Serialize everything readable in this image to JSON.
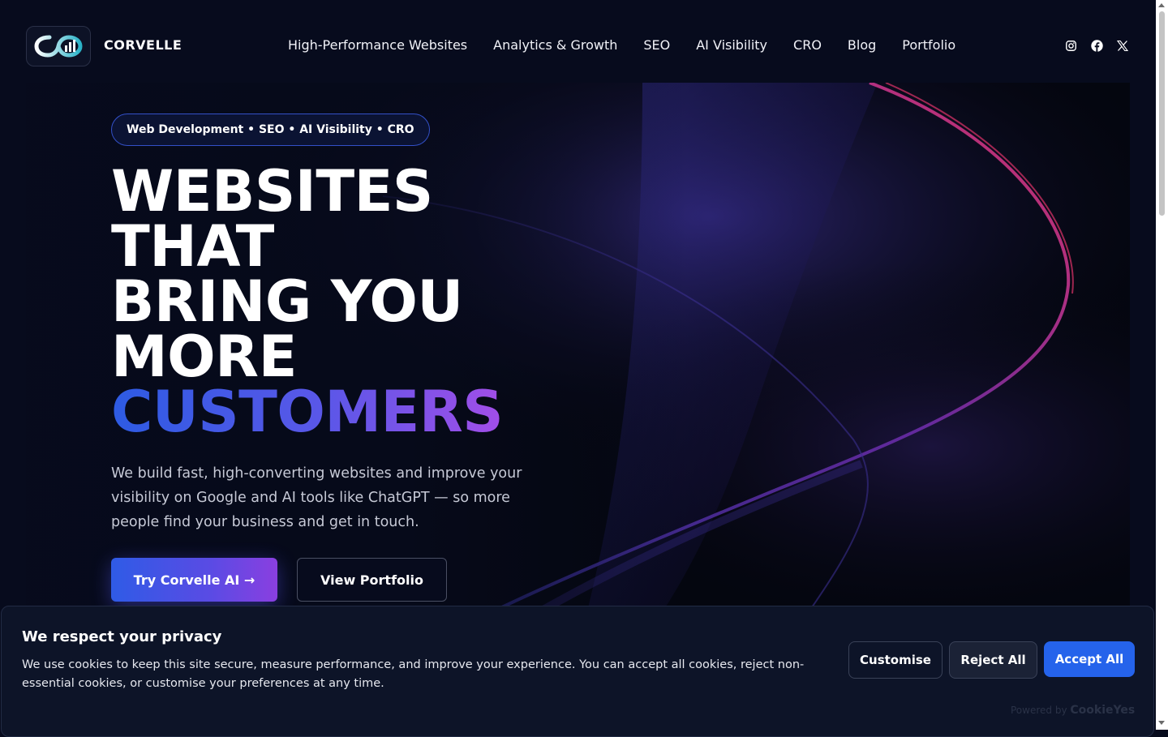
{
  "brand": {
    "name": "CORVELLE",
    "logo_icon": "infinity-chart-logo-icon"
  },
  "nav": {
    "items": [
      {
        "label": "High-Performance Websites"
      },
      {
        "label": "Analytics & Growth"
      },
      {
        "label": "SEO"
      },
      {
        "label": "AI Visibility"
      },
      {
        "label": "CRO"
      },
      {
        "label": "Blog"
      },
      {
        "label": "Portfolio"
      }
    ]
  },
  "socials": [
    "instagram-icon",
    "facebook-icon",
    "x-icon"
  ],
  "hero": {
    "pill": "Web Development • SEO • AI Visibility • CRO",
    "headline_lines": [
      "WEBSITES",
      "THAT",
      "BRING YOU",
      "MORE"
    ],
    "headline_accent": "CUSTOMERS",
    "lead": "We build fast, high-converting websites and improve your visibility on Google and AI tools like ChatGPT — so more people find your business and get in touch.",
    "primary_cta": "Try Corvelle AI →",
    "secondary_cta": "View Portfolio"
  },
  "cookie": {
    "title": "We respect your privacy",
    "text": "We use cookies to keep this site secure, measure performance, and improve your experience. You can accept all cookies, reject non-essential cookies, or customise your preferences at any time.",
    "customise": "Customise",
    "reject": "Reject All",
    "accept": "Accept All",
    "powered_prefix": "Powered by",
    "powered_brand": "CookieYes"
  },
  "colors": {
    "background": "#070b1d",
    "accent_blue": "#2563eb",
    "accent_purple": "#a24ee8",
    "banner": "#0d1428"
  }
}
